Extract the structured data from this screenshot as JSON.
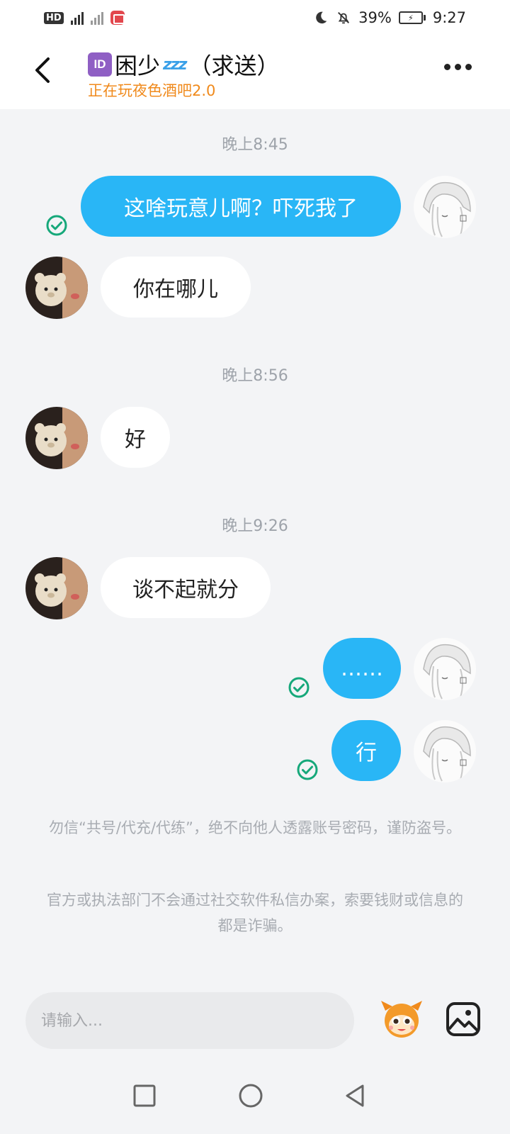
{
  "status_bar": {
    "hd": "HD",
    "network": "4G",
    "battery_percent": "39%",
    "time": "9:27"
  },
  "header": {
    "title": "困少",
    "title_suffix": "（求送）",
    "id_badge": "ID",
    "zzz": "zzz",
    "subtitle": "正在玩夜色酒吧2.0"
  },
  "messages": [
    {
      "type": "time",
      "text": "晚上8:45"
    },
    {
      "type": "out",
      "text": "这啥玩意儿啊？吓死我了",
      "read": true
    },
    {
      "type": "in",
      "text": "你在哪儿"
    },
    {
      "type": "time",
      "text": "晚上8:56"
    },
    {
      "type": "in",
      "text": "好"
    },
    {
      "type": "time",
      "text": "晚上9:26"
    },
    {
      "type": "in",
      "text": "谈不起就分"
    },
    {
      "type": "out",
      "text": "……",
      "read": true
    },
    {
      "type": "out",
      "text": "行",
      "read": true
    }
  ],
  "notices": [
    "勿信“共号/代充/代练”，绝不向他人透露账号密码，谨防盗号。",
    "官方或执法部门不会通过社交软件私信办案，索要钱财或信息的都是诈骗。"
  ],
  "input": {
    "placeholder": "请输入..."
  },
  "icons": {
    "back": "chevron-left-icon",
    "more": "more-dots-icon",
    "emoji": "mascot-emoji-icon",
    "image": "image-icon",
    "read": "check-circle-icon",
    "nav_recent": "square-icon",
    "nav_home": "circle-icon",
    "nav_back": "triangle-back-icon"
  },
  "colors": {
    "outgoing_bubble": "#29b6f6",
    "incoming_bubble": "#ffffff",
    "subtitle": "#f08a1c",
    "read_check": "#16a87a",
    "background": "#f3f4f6"
  }
}
